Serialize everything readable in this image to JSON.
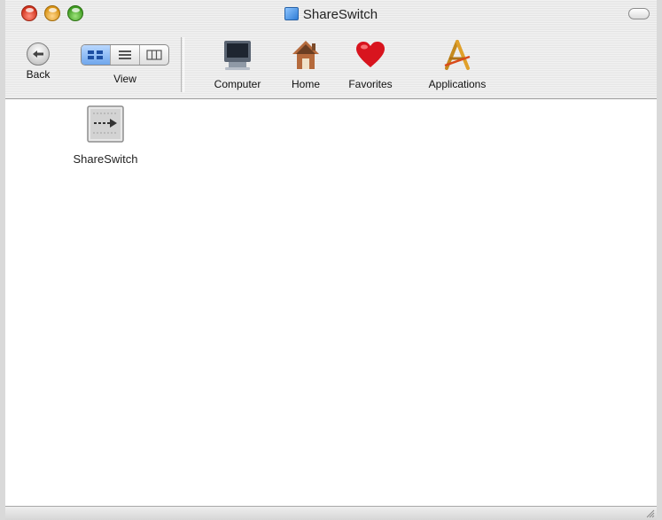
{
  "window": {
    "title": "ShareSwitch",
    "title_icon": "folder-icon"
  },
  "toolbar": {
    "back_label": "Back",
    "view_label": "View",
    "view_modes": [
      "icon-view",
      "list-view",
      "column-view"
    ],
    "active_view": "icon-view",
    "places": [
      {
        "label": "Computer",
        "icon": "computer-icon"
      },
      {
        "label": "Home",
        "icon": "home-icon"
      },
      {
        "label": "Favorites",
        "icon": "heart-icon"
      },
      {
        "label": "Applications",
        "icon": "applications-icon"
      }
    ]
  },
  "files": [
    {
      "name": "ShareSwitch",
      "icon": "application-file-icon"
    }
  ],
  "colors": {
    "close": "#d0321c",
    "minimize": "#d99416",
    "zoom": "#3e9b21",
    "favorites_heart": "#d8141e",
    "view_active": "#6fa6ec"
  }
}
